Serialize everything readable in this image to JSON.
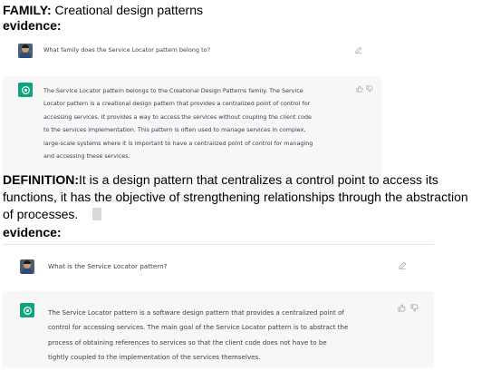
{
  "section1": {
    "label": "FAMILY:",
    "value": " Creational design patterns",
    "evidence_label": "evidence:",
    "question": "What family does the Service Locator pattern belong to?",
    "answer_lines": [
      "The Service Locator pattern belongs to the Creational Design Patterns family. The Service",
      "Locator pattern is a creational design pattern that provides a centralized point of control for",
      "accessing services. It provides a way to access the services without coupling the client code",
      "to the services implementation. This pattern is often used to manage services in complex,",
      "large-scale systems where it is important to have a centralized point of control for managing",
      "and accessing these services."
    ]
  },
  "section2": {
    "label": "DEFINITION:",
    "definition_lines": [
      "It is a design pattern that centralizes a control point to access its",
      "functions, it has the objective of strengthening relationships through the abstraction",
      "of processes."
    ],
    "evidence_label": "evidence:",
    "question": "What is the Service Locator pattern?",
    "answer_lines": [
      "The Service Locator pattern is a software design pattern that provides a centralized point of",
      "control for accessing services. The main goal of the Service Locator pattern is to abstract the",
      "process of obtaining references to services so that the client code does not have to be",
      "tightly coupled to the implementation of the services themselves."
    ]
  },
  "icons": {
    "edit": "edit-icon",
    "thumbs_up": "thumbs-up-icon",
    "thumbs_down": "thumbs-down-icon",
    "bot": "openai-logo-icon",
    "user": "user-avatar"
  },
  "colors": {
    "bot_bg": "#f7f7f8",
    "bot_avatar": "#10a37f",
    "text_gray": "#374151"
  }
}
